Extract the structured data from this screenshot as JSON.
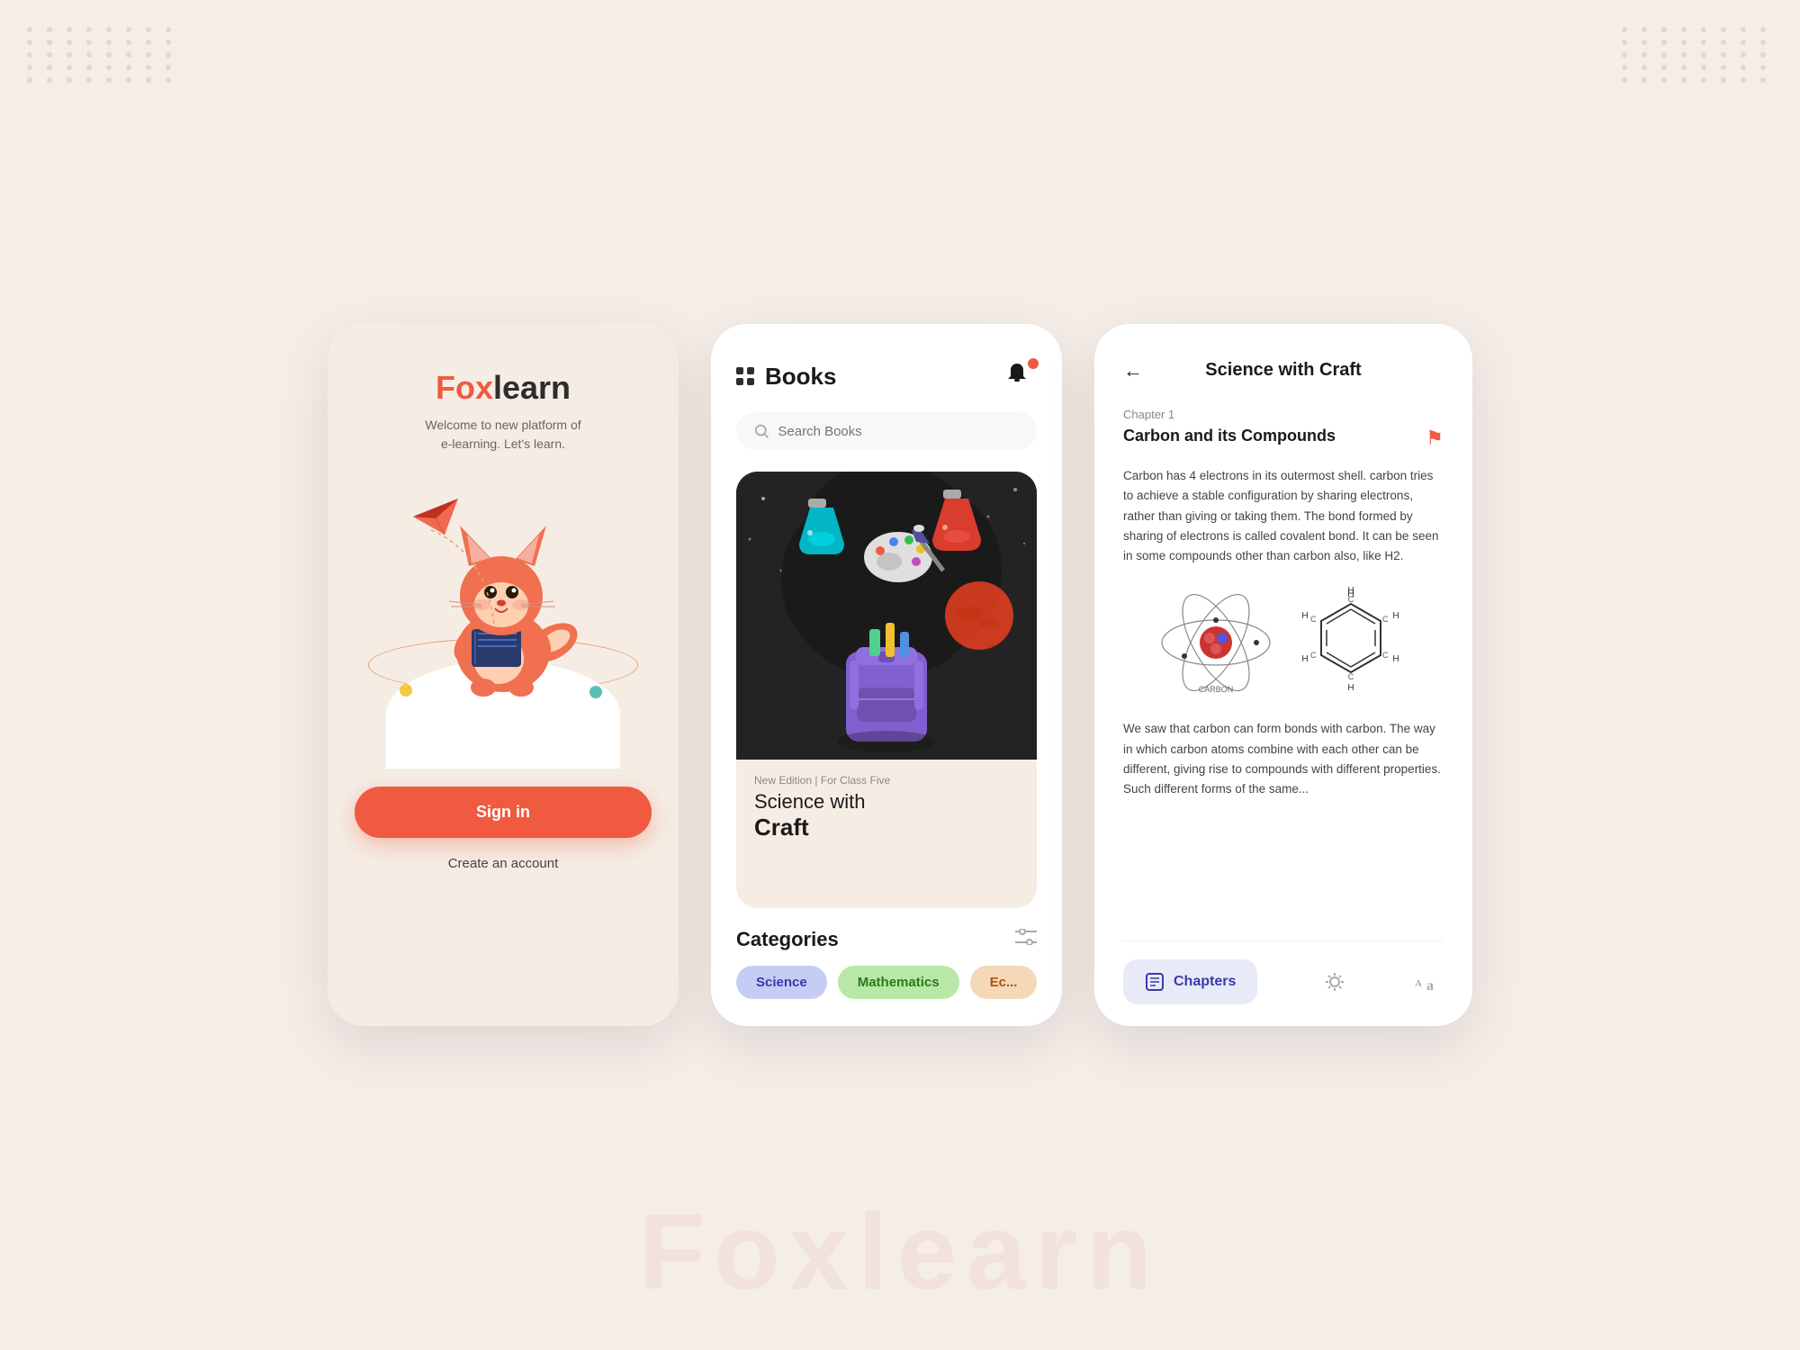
{
  "background": {
    "color": "#f5ede8"
  },
  "watermark": {
    "text": "Foxlearn"
  },
  "screen1": {
    "logo_fox": "Fox",
    "logo_learn": "learn",
    "tagline": "Welcome to new platform of\ne-learning. Let's learn.",
    "signin_button": "Sign in",
    "create_account": "Create an account"
  },
  "screen2": {
    "title": "Books",
    "search_placeholder": "Search Books",
    "book_edition": "New Edition | For Class Five",
    "book_name_line1": "Science with",
    "book_name_line2": "Craft",
    "categories_title": "Categories",
    "categories": [
      {
        "label": "Science",
        "style": "chip-blue"
      },
      {
        "label": "Mathematics",
        "style": "chip-green"
      },
      {
        "label": "Ec...",
        "style": "chip-peach"
      }
    ]
  },
  "screen3": {
    "title": "Science with Craft",
    "chapter_label": "Chapter 1",
    "chapter_title": "Carbon and its Compounds",
    "paragraph1": "Carbon has 4 electrons in its outermost shell. carbon tries to achieve a stable configuration by sharing electrons, rather than giving or taking them. The bond formed by sharing of electrons is called covalent bond. It can be seen in some compounds other than carbon also, like H2.",
    "paragraph2": "We saw that carbon can form bonds with carbon. The way in which carbon atoms combine with each other can be different, giving rise to compounds with different properties. Such different forms of the same...",
    "chapters_button": "Chapters",
    "carbon_label": "CARBON"
  }
}
